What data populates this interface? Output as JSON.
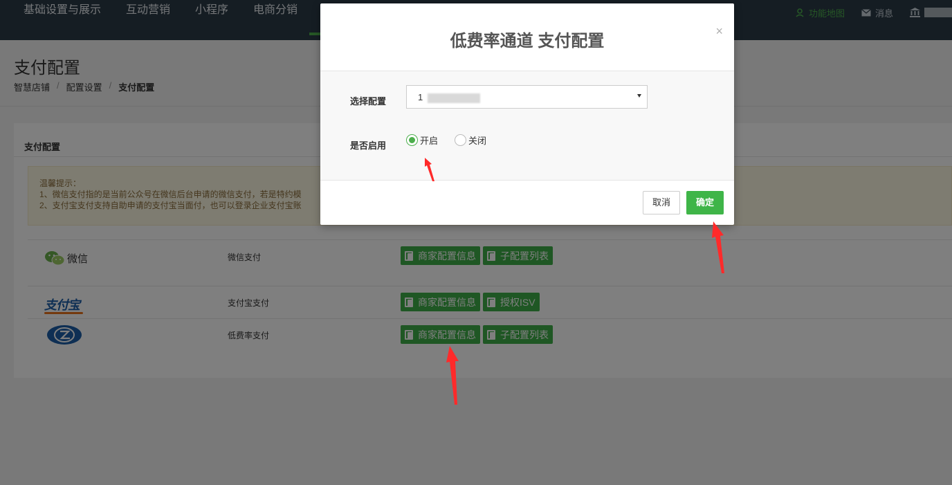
{
  "topnav": {
    "menu": [
      "基础设置与展示",
      "互动营销",
      "小程序",
      "电商分销"
    ],
    "right": [
      {
        "icon": "user-map-icon",
        "label": "功能地图"
      },
      {
        "icon": "envelope-icon",
        "label": "消息"
      },
      {
        "icon": "bank-icon",
        "label": ""
      }
    ]
  },
  "page": {
    "title": "支付配置",
    "breadcrumb": [
      "智慧店铺",
      "配置设置",
      "支付配置"
    ]
  },
  "panel": {
    "title": "支付配置",
    "tip_title": "温馨提示：",
    "tip_line1": "1、微信支付指的是当前公众号在微信后台申请的微信支付，若是特约模",
    "tip_line2": "2、支付宝支付支持自助申请的支付宝当面付，也可以登录企业支付宝账"
  },
  "payments": [
    {
      "logo_label": "微信",
      "name": "微信支付",
      "buttons": [
        "商家配置信息",
        "子配置列表"
      ]
    },
    {
      "logo_label": "支付宝",
      "name": "支付宝支付",
      "buttons": [
        "商家配置信息",
        "授权ISV"
      ]
    },
    {
      "logo_label": "",
      "name": "低费率支付",
      "buttons": [
        "商家配置信息",
        "子配置列表"
      ]
    }
  ],
  "modal": {
    "title": "低费率通道 支付配置",
    "close": "×",
    "select_label": "选择配置",
    "select_value": "1",
    "enable_label": "是否启用",
    "radio_on": "开启",
    "radio_off": "关闭",
    "enabled": true,
    "cancel": "取消",
    "ok": "确定"
  },
  "colors": {
    "accent": "#3fae49",
    "nav_bg": "#2b3a47",
    "annotation": "#ff2a2a"
  }
}
